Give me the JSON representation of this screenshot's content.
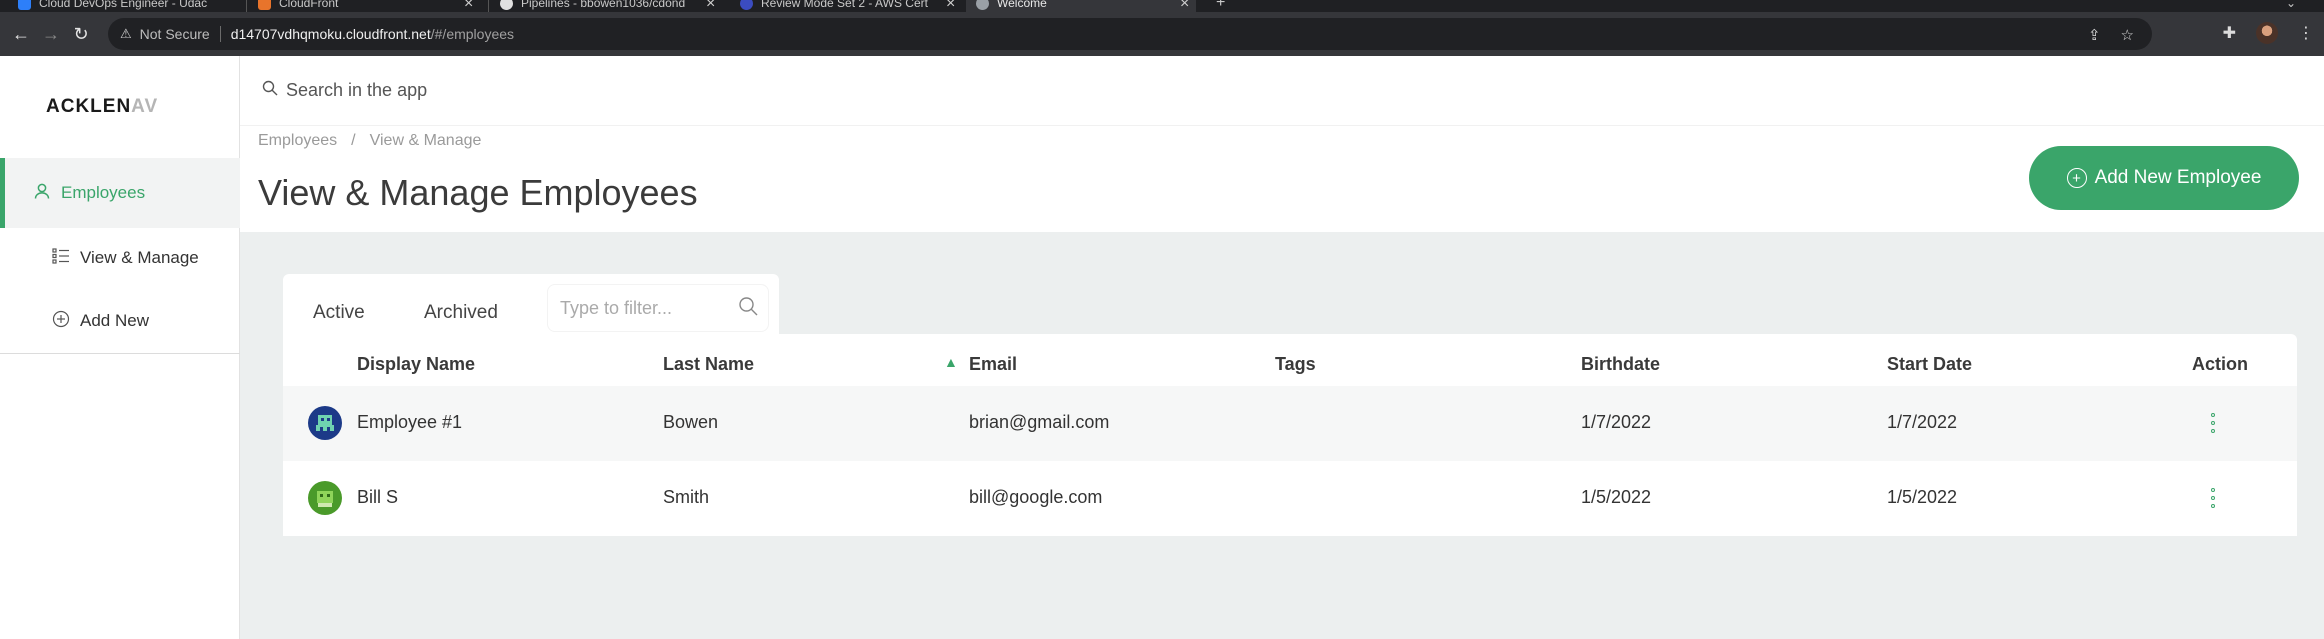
{
  "browser": {
    "tabs": [
      {
        "title": "Cloud DevOps Engineer - Udac",
        "favicon_color": "#2d7ff9",
        "active": false
      },
      {
        "title": "CloudFront",
        "favicon_color": "#e8742b",
        "active": false
      },
      {
        "title": "Pipelines - bbowen1036/cdond",
        "favicon_color": "#e0e0e0",
        "active": false
      },
      {
        "title": "Review Mode Set 2 - AWS Cert",
        "favicon_color": "#3b4cc0",
        "active": false
      },
      {
        "title": "Welcome",
        "favicon_color": "#9aa0a6",
        "active": true
      }
    ],
    "new_tab_label": "+",
    "security_label": "Not Secure",
    "url_host": "d14707vdhqmoku.cloudfront.net",
    "url_path": "/#/employees"
  },
  "app": {
    "logo_main": "ACKLEN",
    "logo_fade": "AV",
    "search_placeholder": "Search in the app",
    "sidebar": {
      "items": [
        {
          "label": "Employees",
          "icon": "user-icon"
        },
        {
          "label": "View & Manage",
          "icon": "list-icon"
        },
        {
          "label": "Add New",
          "icon": "plus-circle-icon"
        }
      ]
    },
    "breadcrumb": [
      "Employees",
      "View & Manage"
    ],
    "breadcrumb_sep": "/",
    "page_title": "View & Manage Employees",
    "add_button_label": "Add New Employee",
    "tabs": [
      "Active",
      "Archived"
    ],
    "filter_placeholder": "Type to filter...",
    "accent_color": "#3aa56a",
    "table": {
      "columns": [
        "Display Name",
        "Last Name",
        "Email",
        "Tags",
        "Birthdate",
        "Start Date",
        "Action"
      ],
      "sorted_column": "Email",
      "rows": [
        {
          "display_name": "Employee #1",
          "last_name": "Bowen",
          "email": "brian@gmail.com",
          "tags": "",
          "birthdate": "1/7/2022",
          "start_date": "1/7/2022"
        },
        {
          "display_name": "Bill S",
          "last_name": "Smith",
          "email": "bill@google.com",
          "tags": "",
          "birthdate": "1/5/2022",
          "start_date": "1/5/2022"
        }
      ]
    }
  }
}
